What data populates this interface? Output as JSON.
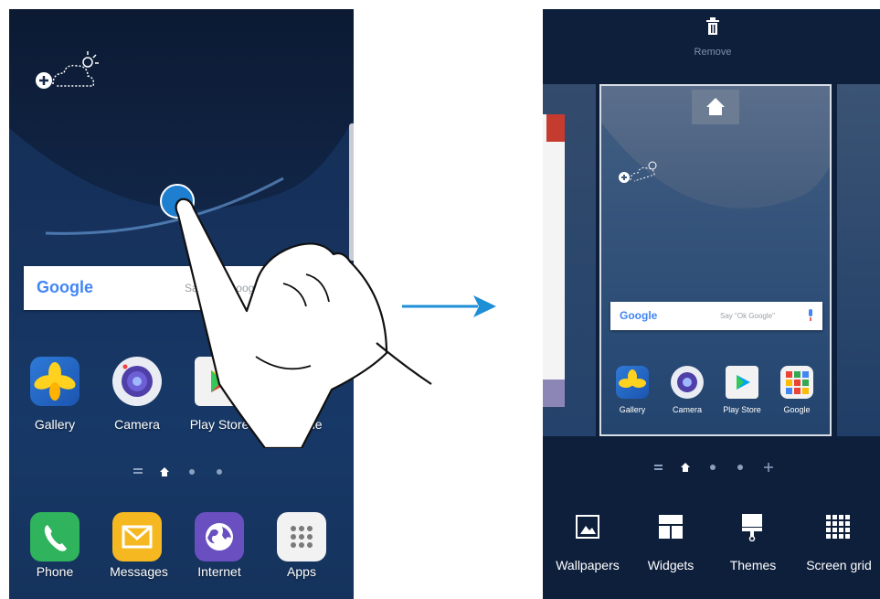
{
  "left_screen": {
    "google_logo": "Google",
    "search_hint": "Say \"Ok Google\"",
    "apps": [
      "Gallery",
      "Camera",
      "Play Store",
      "Google"
    ],
    "dock": [
      "Phone",
      "Messages",
      "Internet",
      "Apps"
    ]
  },
  "right_screen": {
    "remove_label": "Remove",
    "google_logo": "Google",
    "search_hint": "Say \"Ok Google\"",
    "apps": [
      "Gallery",
      "Camera",
      "Play Store",
      "Google"
    ],
    "options": [
      "Wallpapers",
      "Widgets",
      "Themes",
      "Screen grid"
    ]
  },
  "colors": {
    "arrow": "#1e8fd6",
    "wallpaper": "#13294d",
    "touch_dot": "#1e7fd0"
  }
}
